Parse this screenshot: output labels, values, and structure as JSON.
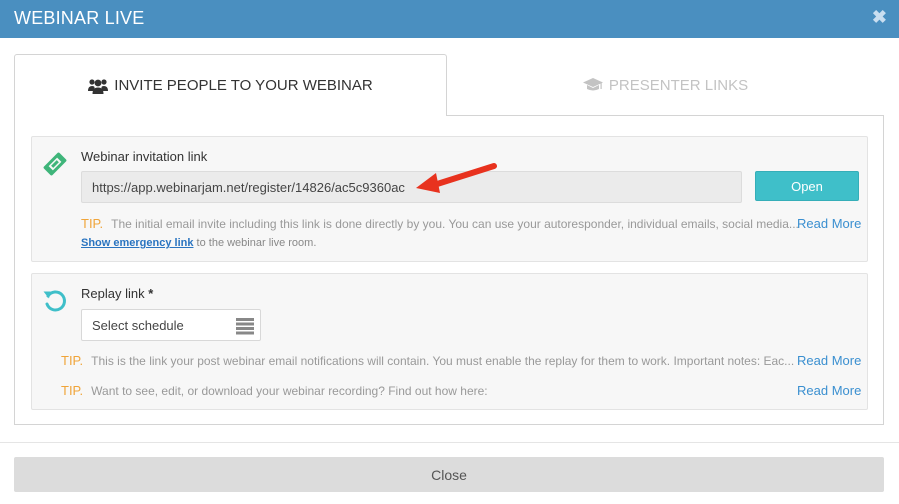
{
  "window": {
    "title": "WEBINAR LIVE",
    "close_glyph": "✖"
  },
  "tabs": [
    {
      "label": "INVITE PEOPLE TO YOUR WEBINAR",
      "icon": "users-icon",
      "active": true
    },
    {
      "label": "PRESENTER LINKS",
      "icon": "graduation-cap-icon",
      "active": false
    }
  ],
  "invitation": {
    "icon": "ticket-icon",
    "label": "Webinar invitation link",
    "url": "https://app.webinarjam.net/register/14826/ac5c9360ac",
    "open_label": "Open",
    "tip_word": "TIP.",
    "tip_text": "The initial email invite including this link is done directly by you. You can use your autoresponder, individual emails, social media...",
    "read_more": "Read More",
    "emergency_link": "Show emergency link",
    "emergency_suffix": " to the webinar live room."
  },
  "replay": {
    "icon": "refresh-icon",
    "label": "Replay link",
    "required_mark": "*",
    "select_value": "Select schedule",
    "tips": [
      {
        "tip_word": "TIP.",
        "text": "This is the link your post webinar email notifications will contain. You must enable the replay for them to work. Important notes: Eac...",
        "read_more": "Read More"
      },
      {
        "tip_word": "TIP.",
        "text": "Want to see, edit, or download your webinar recording? Find out how here:",
        "read_more": "Read More"
      }
    ]
  },
  "footer": {
    "close_label": "Close"
  },
  "colors": {
    "titlebar": "#4a8fc0",
    "accent": "#3fbfc9",
    "tip": "#f0a53a",
    "link": "#3a8fd0",
    "annotation_arrow": "#e8321e"
  }
}
